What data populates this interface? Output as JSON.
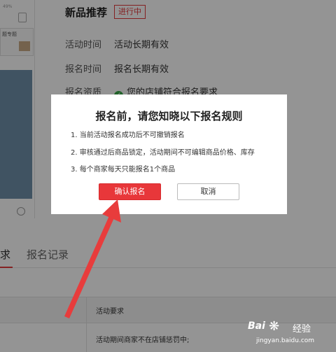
{
  "phone": {
    "status": "49%",
    "card_title": "题专题"
  },
  "header": {
    "title": "新品推荐",
    "status_badge": "进行中"
  },
  "info": [
    {
      "label": "活动时间",
      "value": "活动长期有效"
    },
    {
      "label": "报名时间",
      "value": "报名长期有效"
    },
    {
      "label": "报名资质",
      "value": "您的店铺符合报名要求"
    }
  ],
  "tabs": [
    {
      "label": "求"
    },
    {
      "label": "报名记录"
    }
  ],
  "table": {
    "header_requirement": "活动要求",
    "row_requirement": "活动期间商家不在店铺惩罚中;"
  },
  "modal": {
    "title": "报名前，请您知晓以下报名规则",
    "rules": [
      "1. 当前活动报名成功后不可撤销报名",
      "2. 审核通过后商品锁定，活动期间不可编辑商品价格、库存",
      "3. 每个商家每天只能报名1个商品"
    ],
    "confirm_label": "确认报名",
    "cancel_label": "取消"
  },
  "colors": {
    "accent": "#e4393c",
    "confirm_button": "#e8373a",
    "check": "#3aa948",
    "arrow": "#e83c3c"
  },
  "watermark": {
    "brand": "Bai",
    "brand_cn": "经验",
    "url": "jingyan.baidu.com"
  }
}
